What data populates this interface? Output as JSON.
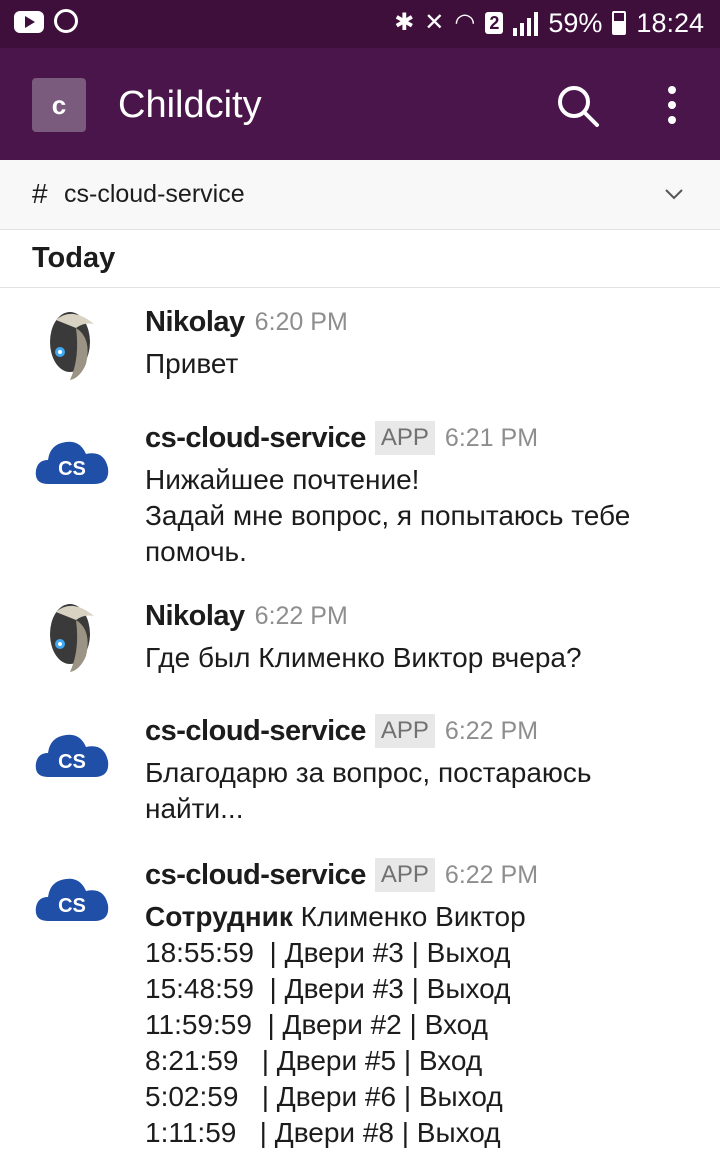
{
  "status_bar": {
    "battery": "59%",
    "time": "18:24",
    "sim": "2"
  },
  "header": {
    "workspace_initial": "c",
    "workspace_name": "Childcity"
  },
  "channel": {
    "hash": "#",
    "name": "cs-cloud-service"
  },
  "day_divider": "Today",
  "messages": [
    {
      "author": "Nikolay",
      "time": "6:20 PM",
      "lines": [
        "Привет"
      ]
    },
    {
      "author": "cs-cloud-service",
      "badge": "APP",
      "time": "6:21 PM",
      "lines": [
        "Нижайшее почтение!",
        "Задай мне вопрос, я попытаюсь тебе",
        "помочь."
      ]
    },
    {
      "author": "Nikolay",
      "time": "6:22 PM",
      "lines": [
        "Где был Клименко Виктор вчера?"
      ]
    },
    {
      "author": "cs-cloud-service",
      "badge": "APP",
      "time": "6:22 PM",
      "lines": [
        "Благодарю за вопрос, постараюсь",
        "найти..."
      ]
    },
    {
      "author": "cs-cloud-service",
      "badge": "APP",
      "time": "6:22 PM",
      "employee_label": "Сотрудник",
      "employee_name": "Клименко Виктор",
      "log": [
        "18:55:59  | Двери #3 | Выход",
        "15:48:59  | Двери #3 | Выход",
        "11:59:59  | Двери #2 | Вход",
        "8:21:59   | Двери #5 | Вход",
        "5:02:59   | Двери #6 | Выход",
        "1:11:59   | Двери #8 | Выход"
      ]
    }
  ],
  "colors": {
    "status_bar_bg": "#3d0f3a",
    "header_bg": "#4a154b",
    "cloud_blue": "#1f4fa6"
  }
}
